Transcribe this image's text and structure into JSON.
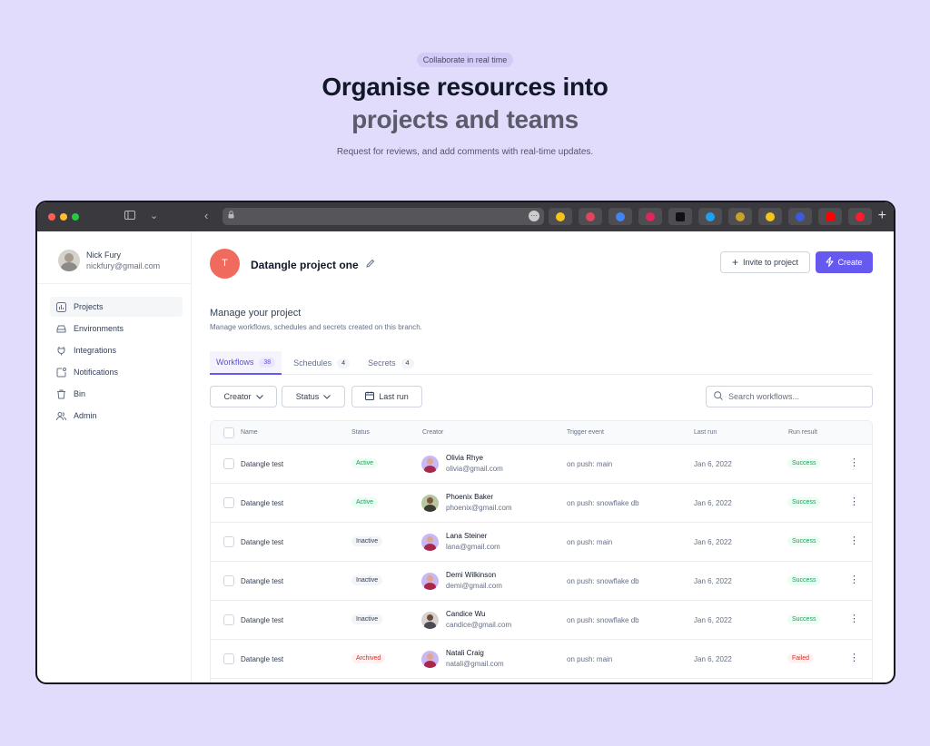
{
  "hero": {
    "pill": "Collaborate in real time",
    "title_line1": "Organise resources into",
    "title_line2": "projects and teams",
    "subtitle": "Request for reviews, and add comments with real-time updates."
  },
  "user": {
    "name": "Nick Fury",
    "email": "nickfury@gmail.com"
  },
  "sidebar": {
    "items": [
      {
        "label": "Projects",
        "icon": "chart-icon"
      },
      {
        "label": "Environments",
        "icon": "drive-icon"
      },
      {
        "label": "Integrations",
        "icon": "plug-icon"
      },
      {
        "label": "Notifications",
        "icon": "bell-square-icon"
      },
      {
        "label": "Bin",
        "icon": "trash-icon"
      },
      {
        "label": "Admin",
        "icon": "users-icon"
      }
    ]
  },
  "project": {
    "initial": "T",
    "title": "Datangle project one",
    "invite_label": "Invite to project",
    "create_label": "Create",
    "manage_title": "Manage your project",
    "manage_sub": "Manage workflows, schedules and secrets created on this branch."
  },
  "tabs": [
    {
      "label": "Workflows",
      "count": "38"
    },
    {
      "label": "Schedules",
      "count": "4"
    },
    {
      "label": "Secrets",
      "count": "4"
    }
  ],
  "filters": {
    "creator": "Creator",
    "status": "Status",
    "last_run": "Last run"
  },
  "search": {
    "placeholder": "Search workflows..."
  },
  "table": {
    "headers": {
      "name": "Name",
      "status": "Status",
      "creator": "Creator",
      "trigger": "Trigger event",
      "last_run": "Last run",
      "result": "Run result"
    },
    "rows": [
      {
        "name": "Datangle test",
        "status": "Active",
        "creator_name": "Olivia Rhye",
        "creator_email": "olivia@gmail.com",
        "trigger": "on push: main",
        "last_run": "Jan 6, 2022",
        "result": "Success"
      },
      {
        "name": "Datangle test",
        "status": "Active",
        "creator_name": "Phoenix Baker",
        "creator_email": "phoenix@gmail.com",
        "trigger": "on push: snowflake db",
        "last_run": "Jan 6, 2022",
        "result": "Success"
      },
      {
        "name": "Datangle test",
        "status": "Inactive",
        "creator_name": "Lana Steiner",
        "creator_email": "lana@gmail.com",
        "trigger": "on push: main",
        "last_run": "Jan 6, 2022",
        "result": "Success"
      },
      {
        "name": "Datangle test",
        "status": "Inactive",
        "creator_name": "Demi Wilkinson",
        "creator_email": "demi@gmail.com",
        "trigger": "on push: snowflake db",
        "last_run": "Jan 6, 2022",
        "result": "Success"
      },
      {
        "name": "Datangle test",
        "status": "Inactive",
        "creator_name": "Candice Wu",
        "creator_email": "candice@gmail.com",
        "trigger": "on push: snowflake db",
        "last_run": "Jan 6, 2022",
        "result": "Success"
      },
      {
        "name": "Datangle test",
        "status": "Archived",
        "creator_name": "Natali Craig",
        "creator_email": "natali@gmail.com",
        "trigger": "on push: main",
        "last_run": "Jan 6, 2022",
        "result": "Failed"
      }
    ]
  },
  "colors": {
    "accent": "#6659f0",
    "background": "#e2dcfc",
    "project_avatar": "#f06a5e"
  }
}
